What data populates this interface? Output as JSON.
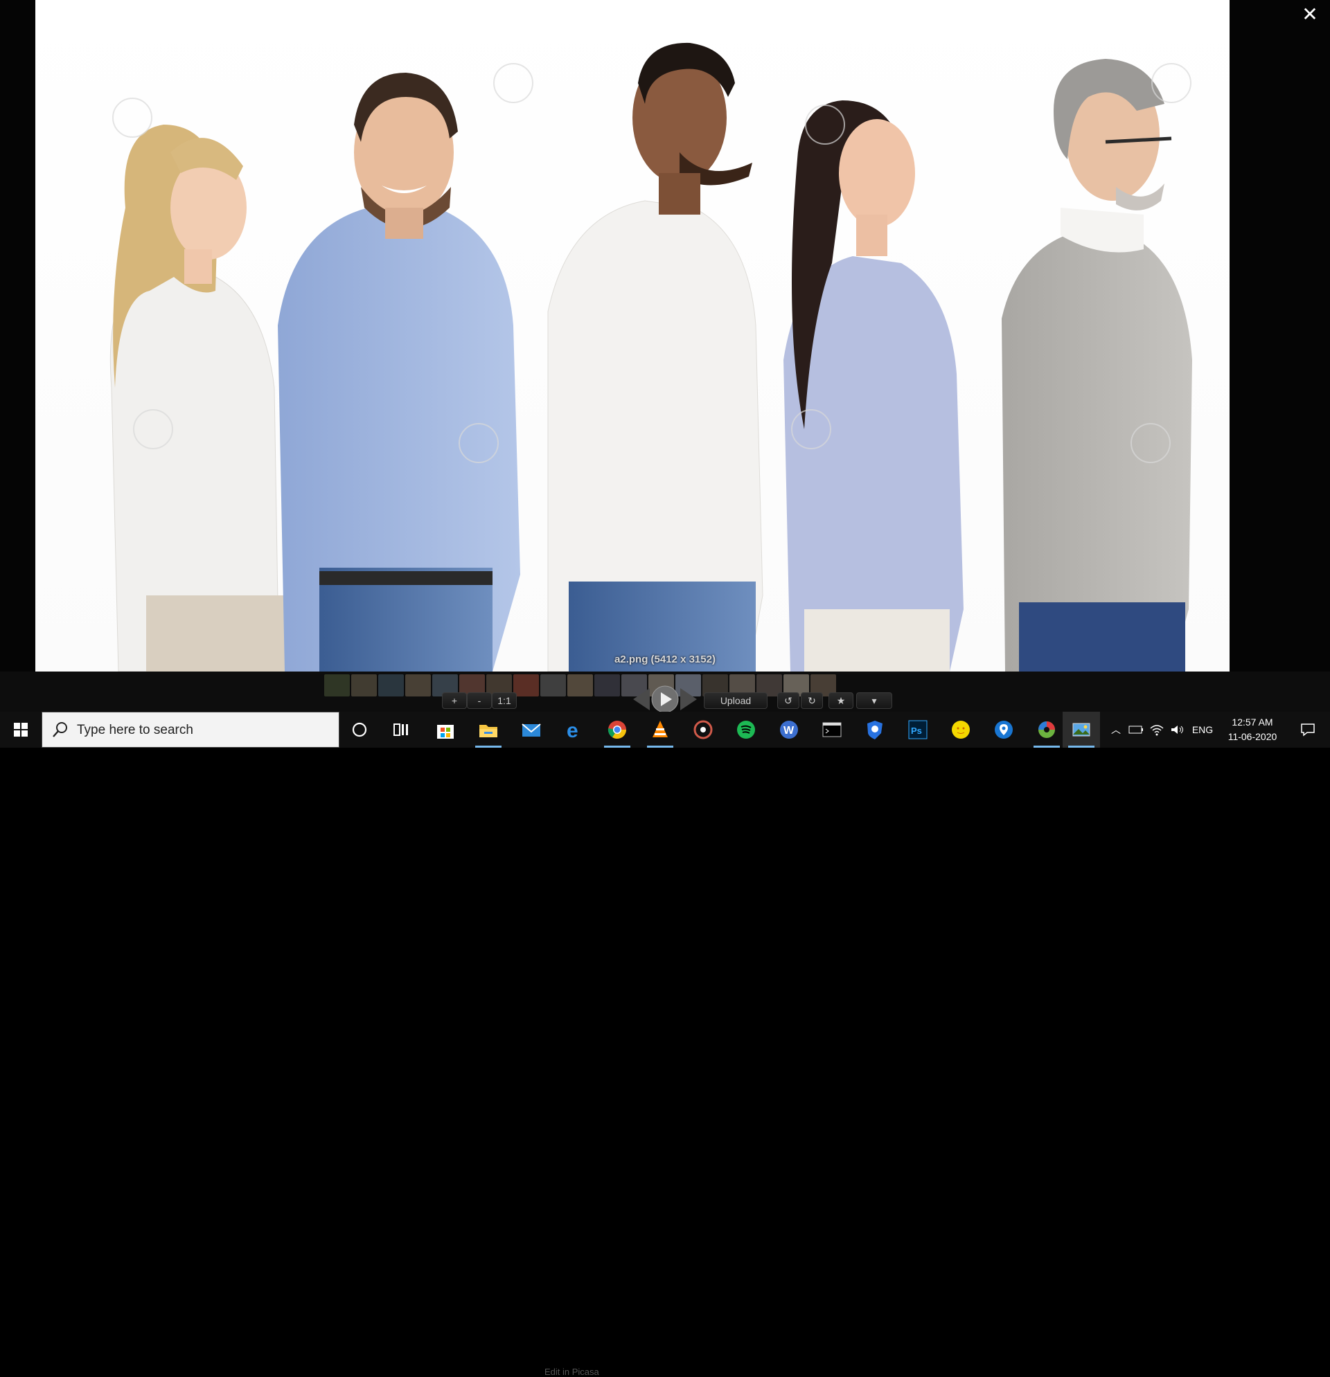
{
  "viewer": {
    "close_icon": "close-icon",
    "caption": "a2.png (5412 x 3152)"
  },
  "picasa": {
    "zoom_in": "+",
    "zoom_out": "-",
    "actual_size": "1:1",
    "edit_label": "Edit in Picasa",
    "upload": "Upload",
    "rotate_left_icon": "rotate-ccw-icon",
    "rotate_right_icon": "rotate-cw-icon",
    "star_icon": "star-icon",
    "more_icon": "chevron-down-icon"
  },
  "taskbar": {
    "search_placeholder": "Type here to search",
    "apps": [
      "cortana",
      "task-view",
      "store",
      "file-explorer",
      "mail",
      "edge",
      "chrome",
      "vlc",
      "media-player",
      "spotify",
      "wps-writer",
      "terminal",
      "antivirus",
      "photoshop",
      "emoji-app",
      "maps",
      "picasa",
      "photos"
    ],
    "language": "ENG",
    "time": "12:57 AM",
    "date": "11-06-2020"
  },
  "colors": {
    "taskbar_bg": "#101010",
    "accent": "#76b9ed",
    "spotify": "#1db954",
    "photoshop": "#001e36"
  }
}
